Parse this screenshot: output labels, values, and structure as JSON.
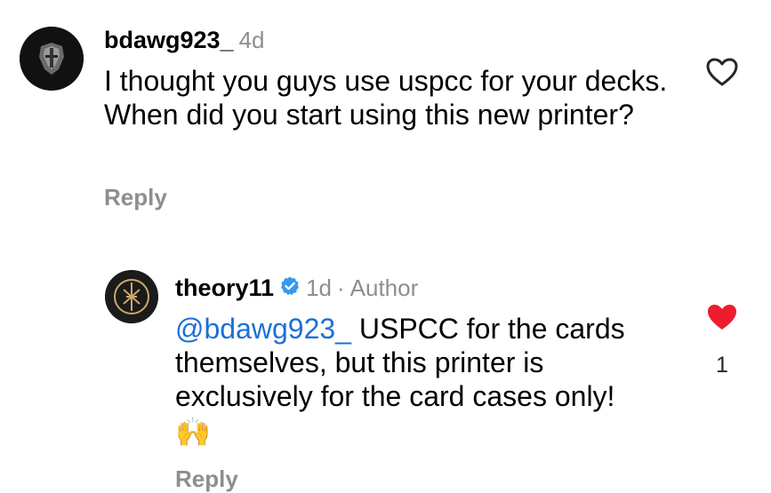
{
  "comments": [
    {
      "username": "bdawg923_",
      "time": "4d",
      "text": "I thought you guys use uspcc for your decks. When did you start using this new printer?",
      "reply_label": "Reply",
      "liked": false
    },
    {
      "username": "theory11",
      "time": "1d",
      "separator": "·",
      "author_tag": "Author",
      "verified": true,
      "mention": "@bdawg923_",
      "text": " USPCC for the cards themselves, but this printer is exclusively for the card cases only!",
      "emoji": "🙌",
      "reply_label": "Reply",
      "liked": true,
      "like_count": "1"
    }
  ],
  "colors": {
    "muted": "#8e8e8e",
    "mention": "#1d6fd8",
    "like_red": "#ed1c2e",
    "verified_blue": "#3897f0"
  }
}
